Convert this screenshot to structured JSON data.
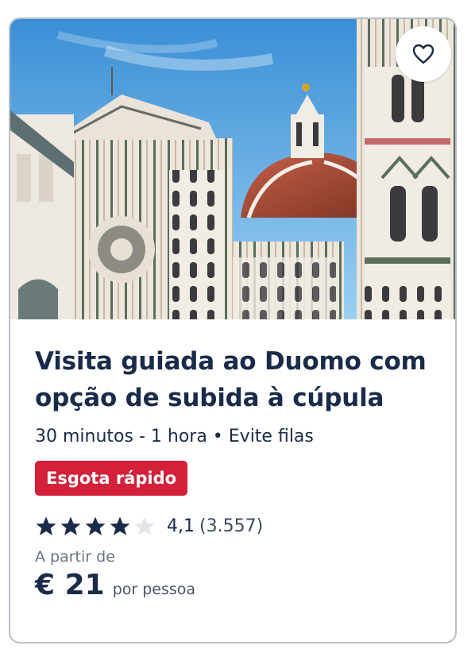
{
  "card": {
    "title": "Visita guiada ao Duomo com opção de subida à cúpula",
    "meta": "30 minutos - 1 hora • Evite filas",
    "badge": "Esgota rápido",
    "rating": {
      "score_text": "4,1",
      "count_text": "(3.557)",
      "stars_value": 4.1,
      "stars_max": 5
    },
    "price_from_label": "A partir de",
    "price": "€ 21",
    "price_unit": "por pessoa"
  },
  "icons": {
    "favorite": "heart-outline-icon",
    "star": "star-icon"
  },
  "colors": {
    "text_primary": "#1a2b4a",
    "badge_bg": "#d3213a",
    "star_filled": "#1a2b4a",
    "star_empty": "#e3e5ea",
    "card_border": "#b9bdc6",
    "sky": "#4aa0e0"
  }
}
